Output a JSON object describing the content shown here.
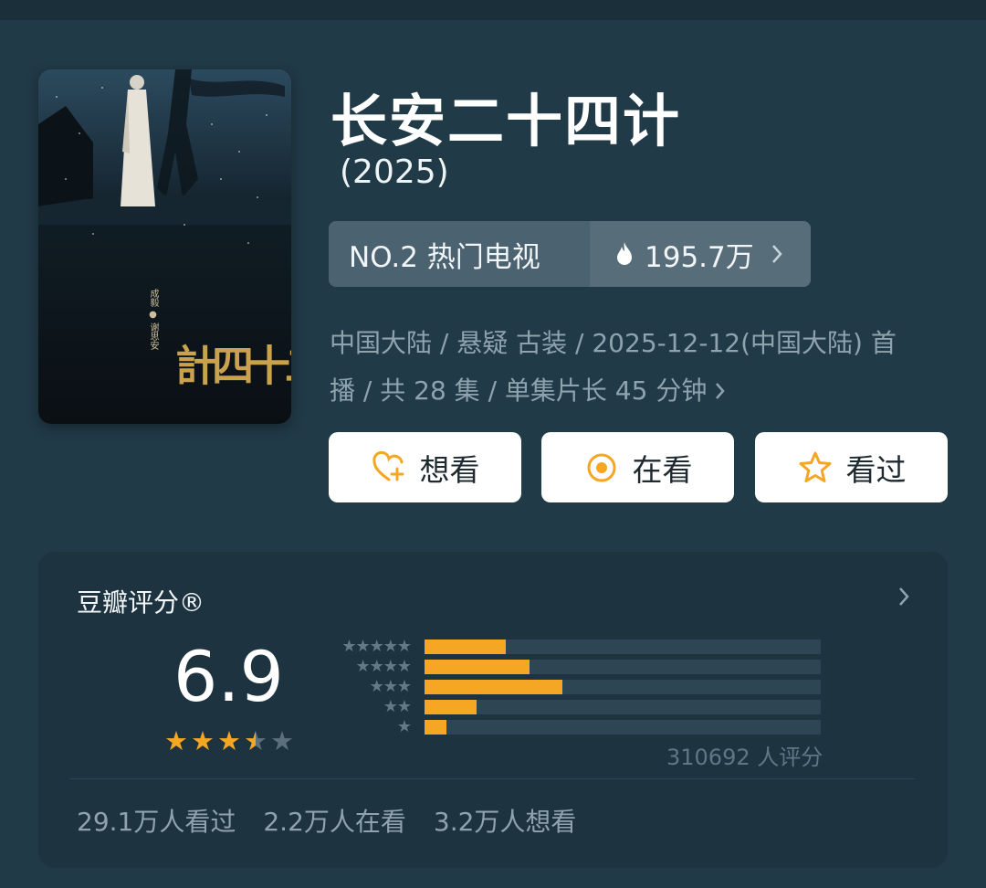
{
  "show": {
    "title": "长安二十四计",
    "year": "(2025)",
    "rank": "NO.2 热门电视",
    "heat": "195.7万",
    "meta_line1": "中国大陆 / 悬疑 古装 / 2025-12-12(中国大陆) 首",
    "meta_line2": "播 / 共 28 集 / 单集片长 45 分钟"
  },
  "poster": {
    "cast_1": "成毅",
    "cast_2": "谢思安",
    "title_art": "長安二十四計"
  },
  "actions": [
    {
      "label": "想看",
      "icon": "heart-plus-icon"
    },
    {
      "label": "在看",
      "icon": "target-circle-icon"
    },
    {
      "label": "看过",
      "icon": "star-outline-icon"
    }
  ],
  "rating": {
    "header": "豆瓣评分®",
    "score": "6.9",
    "stars_value": 3.5,
    "distribution": [
      {
        "stars": "★★★★★",
        "percent": 20.6
      },
      {
        "stars": "★★★★",
        "percent": 26.5
      },
      {
        "stars": "★★★",
        "percent": 34.8
      },
      {
        "stars": "★★",
        "percent": 13.1
      },
      {
        "stars": "★",
        "percent": 5.5
      }
    ],
    "count_text": "310692 人评分",
    "stats": [
      "29.1万人看过",
      "2.2万人在看",
      "3.2万人想看"
    ]
  },
  "colors": {
    "accent": "#f5a623",
    "background": "#213a47",
    "card": "#1d3340"
  }
}
